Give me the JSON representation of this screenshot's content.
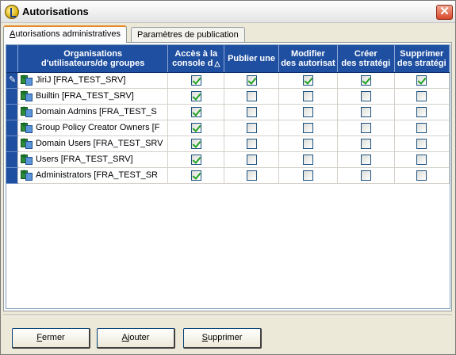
{
  "window": {
    "title": "Autorisations"
  },
  "tabs": [
    {
      "label_first": "A",
      "label_rest": "utorisations administratives",
      "active": true
    },
    {
      "label": "Paramètres de publication",
      "active": false
    }
  ],
  "grid": {
    "headers": [
      {
        "line1": "Organisations",
        "line2": "d'utilisateurs/de groupes"
      },
      {
        "line1": "Accès à la",
        "line2": "console d",
        "sort": "△"
      },
      {
        "line1": "Publier une",
        "line2": ""
      },
      {
        "line1": "Modifier",
        "line2": "des autorisat"
      },
      {
        "line1": "Créer",
        "line2": "des stratégi"
      },
      {
        "line1": "Supprimer",
        "line2": "des stratégi"
      }
    ],
    "rows": [
      {
        "name": "JiriJ [FRA_TEST_SRV]",
        "checks": [
          true,
          true,
          true,
          true,
          true
        ],
        "current": true
      },
      {
        "name": "Builtin [FRA_TEST_SRV]",
        "checks": [
          true,
          false,
          false,
          false,
          false
        ]
      },
      {
        "name": "Domain Admins [FRA_TEST_S",
        "checks": [
          true,
          false,
          false,
          false,
          false
        ]
      },
      {
        "name": "Group Policy Creator Owners [F",
        "checks": [
          true,
          false,
          false,
          false,
          false
        ]
      },
      {
        "name": "Domain Users [FRA_TEST_SRV",
        "checks": [
          true,
          false,
          false,
          false,
          false
        ]
      },
      {
        "name": "Users [FRA_TEST_SRV]",
        "checks": [
          true,
          false,
          false,
          false,
          false
        ]
      },
      {
        "name": "Administrators [FRA_TEST_SR",
        "checks": [
          true,
          false,
          false,
          false,
          false
        ]
      }
    ]
  },
  "buttons": {
    "close_first": "F",
    "close_rest": "ermer",
    "add_first": "A",
    "add_rest": "jouter",
    "delete_first": "S",
    "delete_rest": "upprimer"
  },
  "icons": {
    "close": "close-icon",
    "app": "app-icon",
    "group": "group-icon",
    "edit": "pencil-icon"
  },
  "colors": {
    "header_bg": "#1f4fa0",
    "check": "#21a121",
    "tab_accent": "#e68b2c"
  }
}
